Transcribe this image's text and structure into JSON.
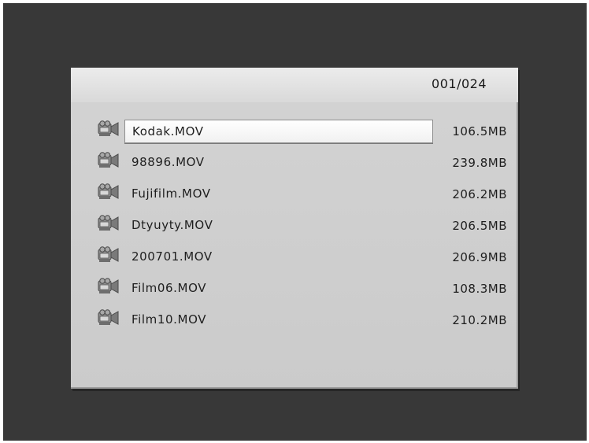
{
  "header": {
    "counter": "001/024"
  },
  "files": [
    {
      "name": "Kodak.MOV",
      "size": "106.5MB",
      "selected": true,
      "icon": "video-file-icon"
    },
    {
      "name": "98896.MOV",
      "size": "239.8MB",
      "selected": false,
      "icon": "video-file-icon"
    },
    {
      "name": "Fujifilm.MOV",
      "size": "206.2MB",
      "selected": false,
      "icon": "video-file-icon"
    },
    {
      "name": "Dtyuyty.MOV",
      "size": "206.5MB",
      "selected": false,
      "icon": "video-file-icon"
    },
    {
      "name": "200701.MOV",
      "size": "206.9MB",
      "selected": false,
      "icon": "video-file-icon"
    },
    {
      "name": "Film06.MOV",
      "size": "108.3MB",
      "selected": false,
      "icon": "video-file-icon"
    },
    {
      "name": "Film10.MOV",
      "size": "210.2MB",
      "selected": false,
      "icon": "video-file-icon"
    }
  ],
  "colors": {
    "background": "#383838",
    "panel": "#cbcbcb",
    "selection": "#ffffff"
  }
}
